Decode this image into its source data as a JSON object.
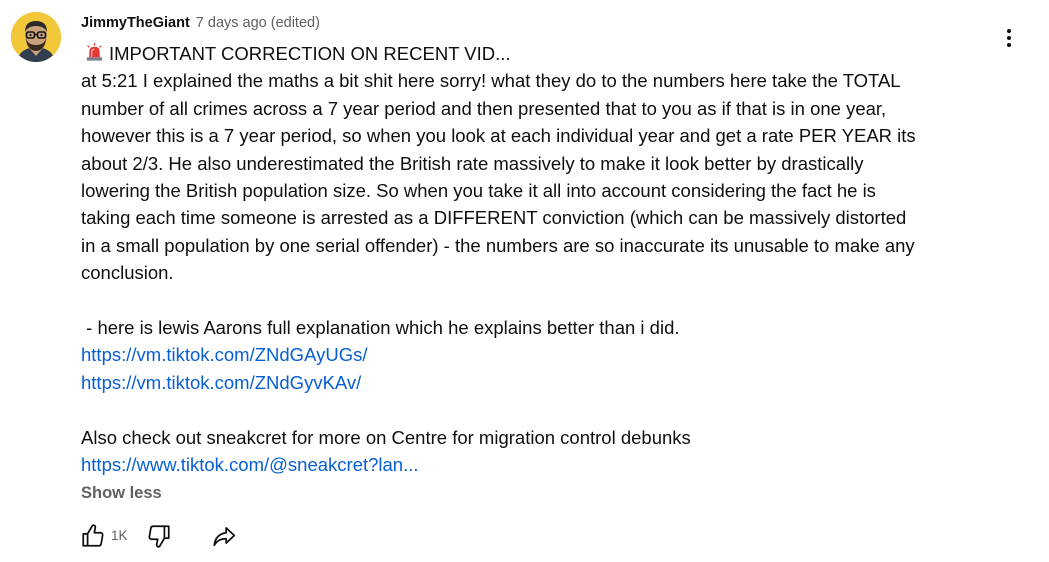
{
  "comment": {
    "author": "JimmyTheGiant",
    "timestamp": "7 days ago (edited)",
    "avatar_icon": "cartoon-avatar",
    "title_emoji": "police-siren-icon",
    "lines": [
      "IMPORTANT CORRECTION ON RECENT VID...",
      "at 5:21 I explained the maths a bit shit here sorry! what they do to the numbers here take the TOTAL",
      "number of all crimes across a 7 year period and then presented that to you as if that is in one year,",
      "however this is a 7 year period, so when you look at each individual year and get a rate PER YEAR its",
      "about 2/3. He also underestimated the British rate massively to make it look better by drastically",
      "lowering the British population size. So when you take it all into account considering the fact he is",
      "taking each time someone is arrested as a DIFFERENT conviction (which can be massively distorted",
      "in a small population by one serial offender) - the numbers are so inaccurate its unusable to make any",
      "conclusion."
    ],
    "explanation_line": " - here is lewis Aarons full explanation which he explains better than i did.",
    "links": [
      "https://vm.tiktok.com/ZNdGAyUGs/",
      "https://vm.tiktok.com/ZNdGyvKAv/"
    ],
    "also_line": "Also check out sneakcret for more on Centre for migration control debunks",
    "sneakcret_link": "https://www.tiktok.com/@sneakcret?lan...",
    "show_less_label": "Show less"
  },
  "actions": {
    "like_count": "1K",
    "like_icon": "thumbs-up-icon",
    "dislike_icon": "thumbs-down-icon",
    "share_icon": "share-icon",
    "menu_icon": "more-vertical-icon"
  },
  "colors": {
    "text": "#0f0f0f",
    "secondary": "#606060",
    "link": "#065fd4",
    "avatar_bg": "#f2c73a"
  }
}
